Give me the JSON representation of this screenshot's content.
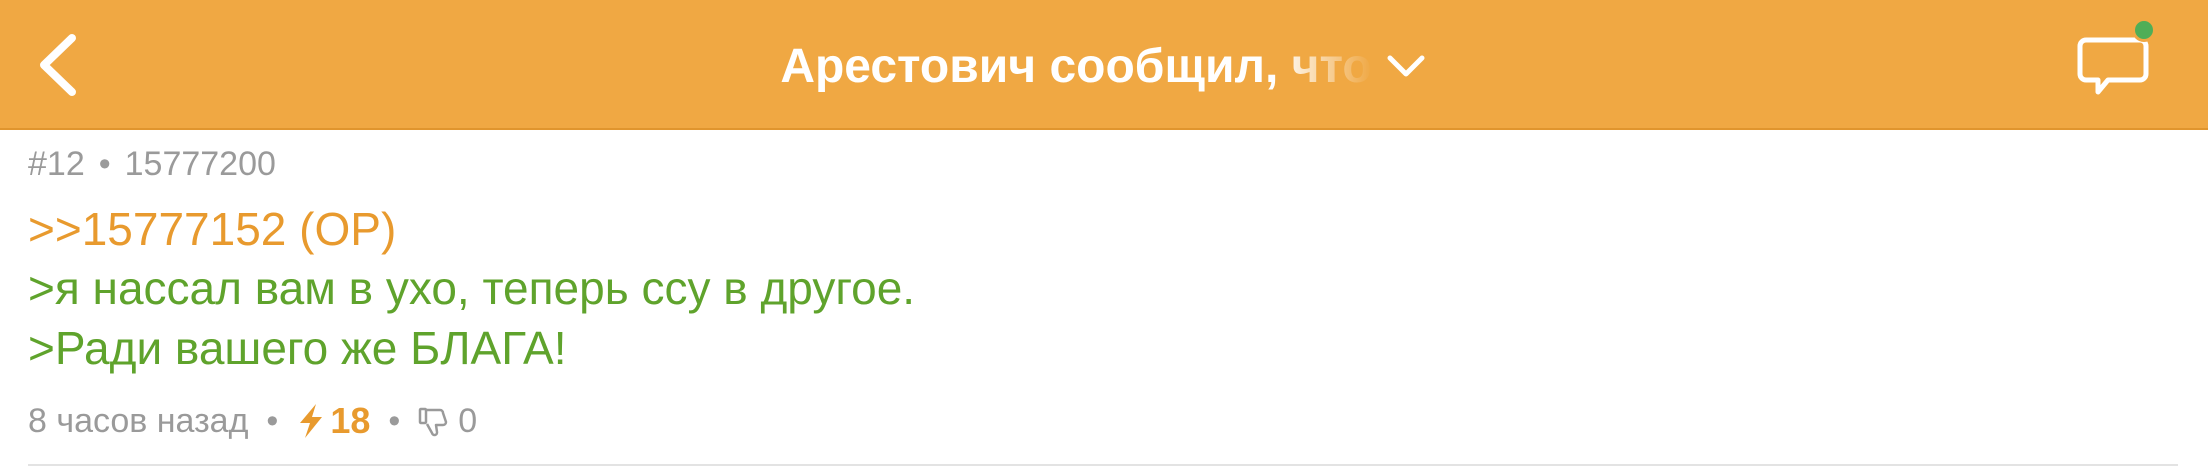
{
  "header": {
    "title": "Арестович сообщил, что",
    "back_icon": "chevron-left-icon",
    "dropdown_icon": "chevron-down-icon",
    "comments_icon": "chat-bubble-icon",
    "online_indicator": true,
    "background_color": "#f0a843",
    "text_color": "#ffffff",
    "indicator_color": "#4fae57"
  },
  "post": {
    "number": "#12",
    "id": "15777200",
    "reply_to": ">>15777152 (OP)",
    "lines": [
      ">я нассал вам в ухо, теперь ссу в другое.",
      ">Ради вашего же БЛАГА!"
    ],
    "time": "8 часов назад",
    "rating": "18",
    "rating_icon": "lightning-icon",
    "dislikes": "0",
    "dislike_icon": "thumbs-down-icon",
    "reply_color": "#e89a2e",
    "quote_color": "#5fa32c"
  }
}
